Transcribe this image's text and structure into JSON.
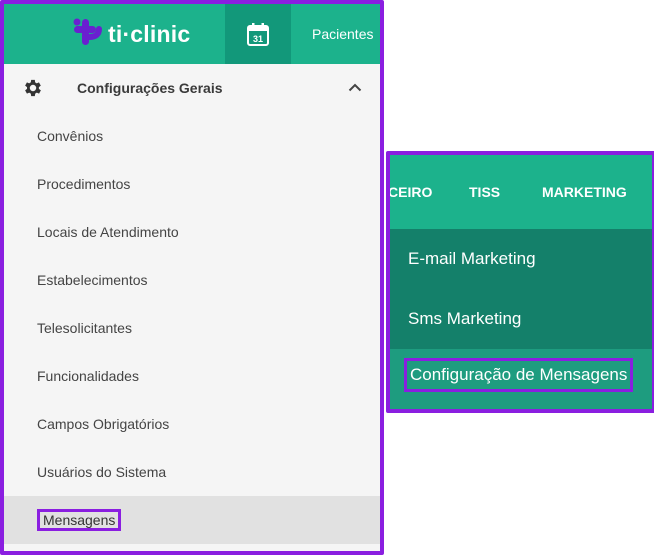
{
  "app": {
    "brand": "ti·clinic",
    "colors": {
      "primary": "#1cb28c",
      "primary_dark": "#14806a",
      "highlight": "#8a1ee0"
    }
  },
  "topbar": {
    "calendar_day": "31",
    "nav_pacientes": "Pacientes"
  },
  "sidebar": {
    "section_title": "Configurações Gerais",
    "section_icon": "gear-icon",
    "items": [
      {
        "label": "Convênios"
      },
      {
        "label": "Procedimentos"
      },
      {
        "label": "Locais de Atendimento"
      },
      {
        "label": "Estabelecimentos"
      },
      {
        "label": "Telesolicitantes"
      },
      {
        "label": "Funcionalidades"
      },
      {
        "label": "Campos Obrigatórios"
      },
      {
        "label": "Usuários do Sistema"
      },
      {
        "label": "Mensagens",
        "active": true
      }
    ]
  },
  "right_menu": {
    "tabs": [
      "CEIRO",
      "TISS",
      "MARKETING"
    ],
    "dropdown": [
      {
        "label": "E-mail Marketing"
      },
      {
        "label": "Sms Marketing"
      },
      {
        "label": "Configuração de Mensagens",
        "active": true
      }
    ]
  }
}
